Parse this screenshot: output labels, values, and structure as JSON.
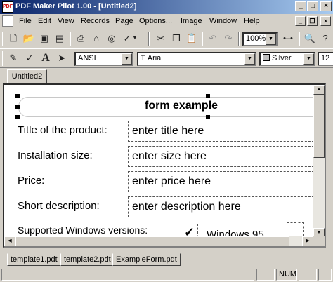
{
  "window": {
    "title": "PDF Maker Pilot 1.00 - [Untitled2]",
    "app_icon": "PDF"
  },
  "window_buttons": {
    "minimize": "_",
    "maximize": "□",
    "close": "×"
  },
  "menu": [
    "File",
    "Edit",
    "View",
    "Records",
    "Page",
    "Options...",
    "Image",
    "Window",
    "Help"
  ],
  "mdi_buttons": {
    "minimize": "_",
    "restore": "❐",
    "close": "×"
  },
  "toolbar1": {
    "icons": [
      "new-icon",
      "open-icon",
      "save-icon",
      "print-icon",
      "print-preview-icon",
      "scan-icon",
      "spellcheck-icon",
      "cut-icon",
      "copy-icon",
      "paste-icon",
      "undo-icon",
      "redo-icon",
      "zoom-icon",
      "help-icon"
    ],
    "zoom_value": "100%"
  },
  "toolbar2": {
    "charset": "ANSI",
    "font_prefix": "Ŧ",
    "font": "Arial",
    "color": "Silver",
    "color_hex": "#c0c0c0",
    "font_size": "12"
  },
  "doc_tab": "Untitled2",
  "form": {
    "title": "form example",
    "rows": [
      {
        "label": "Title of the product:",
        "value": "enter title here"
      },
      {
        "label": "Installation size:",
        "value": "enter size here"
      },
      {
        "label": "Price:",
        "value": "enter price here"
      },
      {
        "label": "Short description:",
        "value": "enter description here"
      }
    ],
    "windows_label": "Supported Windows versions:",
    "windows_option": "Windows 95",
    "windows_check": "✓"
  },
  "bottom_tabs": [
    "template1.pdt",
    "template2.pdt",
    "ExampleForm.pdt"
  ],
  "status": {
    "num": "NUM"
  }
}
